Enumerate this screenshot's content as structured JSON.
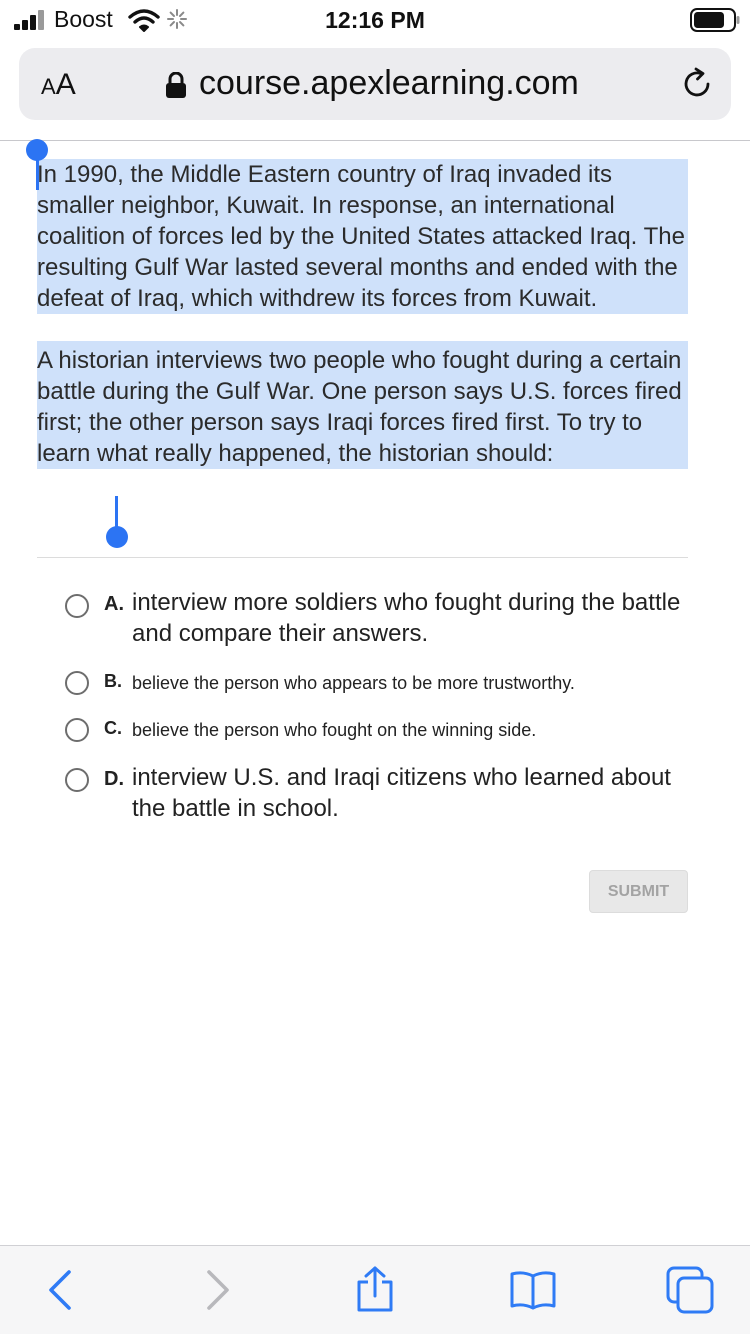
{
  "status_bar": {
    "carrier": "Boost",
    "time": "12:16 PM",
    "icons": [
      "signal-icon",
      "wifi-icon",
      "activity-spinner-icon",
      "battery-icon"
    ]
  },
  "browser": {
    "text_size_label_small": "A",
    "text_size_label_large": "A",
    "url": "course.apexlearning.com",
    "icons": [
      "lock-icon",
      "reload-icon"
    ]
  },
  "question": {
    "passage_paragraph_1": "In 1990, the Middle Eastern country of Iraq invaded its smaller neighbor, Kuwait. In response, an international coalition of forces led by the United States attacked Iraq. The resulting Gulf War lasted several months and ended with the defeat of Iraq, which withdrew its forces from Kuwait.",
    "passage_paragraph_2": "A historian interviews two people who fought during a certain battle during the Gulf War. One person says U.S. forces fired first; the other person says Iraqi forces fired first. To try to learn what really happened, the historian should:",
    "selection_color": "#cfe1fa",
    "handle_color": "#2c74f3"
  },
  "options": [
    {
      "letter": "A.",
      "text": "interview more soldiers who fought during the battle and compare their answers."
    },
    {
      "letter": "B.",
      "text": "believe the person who appears to be more trustworthy."
    },
    {
      "letter": "C.",
      "text": "believe the person who fought on the winning side."
    },
    {
      "letter": "D.",
      "text": "interview U.S. and Iraqi citizens who learned about the battle in school."
    }
  ],
  "submit": {
    "label": "SUBMIT",
    "enabled": false
  },
  "toolbar": {
    "icons": [
      "back-icon",
      "forward-icon",
      "share-icon",
      "bookmarks-icon",
      "tabs-icon"
    ],
    "accent_color": "#2f7bf5",
    "disabled_color": "#b8b8bc"
  }
}
